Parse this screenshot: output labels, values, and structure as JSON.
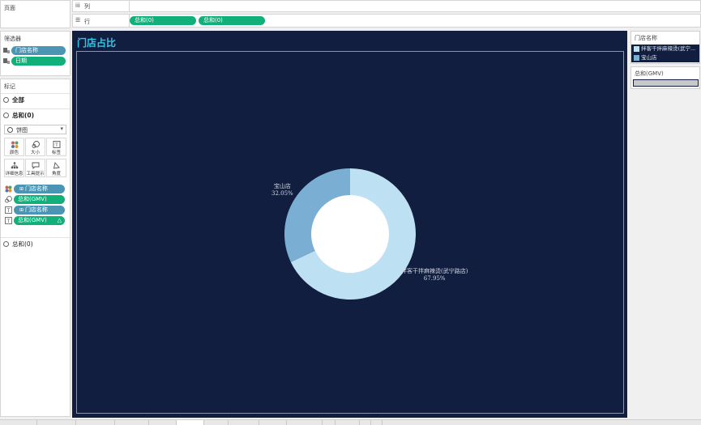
{
  "sidebar": {
    "pages_label": "页面",
    "filters_label": "筛选器",
    "filters": [
      "门店名称",
      "日期"
    ],
    "marks_label": "标记",
    "marks_all": "全部",
    "marks_sum": "总和(0)",
    "mark_type": "饼图",
    "cards": [
      "颜色",
      "大小",
      "标签",
      "详细信息",
      "工具提示",
      "角度"
    ],
    "mark_fields": [
      {
        "label": "门店名称",
        "kind": "dimension"
      },
      {
        "label": "总和(GMV)",
        "kind": "measure"
      },
      {
        "label": "门店名称",
        "kind": "dimension"
      },
      {
        "label": "总和(GMV)",
        "kind": "measure"
      }
    ],
    "marks_sum2": "总和(0)"
  },
  "shelves": {
    "columns_label": "列",
    "rows_label": "行",
    "rows_pills": [
      "总和(0)",
      "总和(0)"
    ]
  },
  "viz": {
    "title": "门店占比",
    "background": "#111e3f",
    "title_color": "#30c8e8"
  },
  "chart_data": {
    "type": "pie",
    "donut": true,
    "categories": [
      "拌客干拌麻辣烫(武宁路店)",
      "宝山店"
    ],
    "values": [
      67.95,
      32.05
    ],
    "value_labels": [
      "67.95%",
      "32.05%"
    ],
    "colors": [
      "#bde0f2",
      "#7aaed3"
    ]
  },
  "legend": {
    "color_title": "门店名称",
    "items": [
      {
        "label": "拌客干拌麻辣烫(武宁...",
        "color": "#bde0f2"
      },
      {
        "label": "宝山店",
        "color": "#7aaed3"
      }
    ],
    "size_title": "总和(GMV)"
  }
}
